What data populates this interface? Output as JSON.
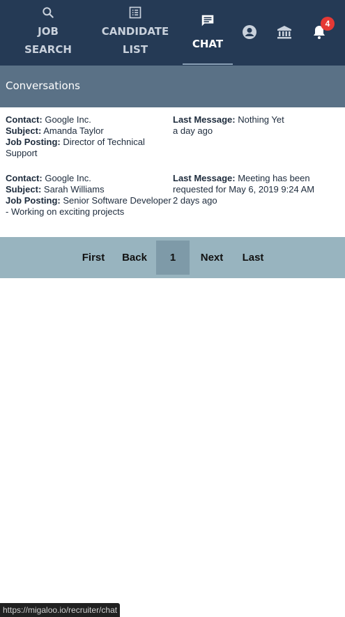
{
  "nav": {
    "items": [
      {
        "icon": "search-icon",
        "label_line1": "JOB",
        "label_line2": "SEARCH"
      },
      {
        "icon": "list-icon",
        "label_line1": "CANDIDATE",
        "label_line2": "LIST"
      },
      {
        "icon": "chat-icon",
        "label": "CHAT",
        "active": true
      }
    ],
    "notification_count": "4"
  },
  "conversations": {
    "title": "Conversations",
    "labels": {
      "contact": "Contact:",
      "subject": "Subject:",
      "job_posting": "Job Posting:",
      "last_message": "Last Message:"
    },
    "rows": [
      {
        "contact": "Google Inc.",
        "subject": "Amanda Taylor",
        "job_posting": "Director of Technical Support",
        "last_message": "Nothing Yet",
        "time": "a day ago"
      },
      {
        "contact": "Google Inc.",
        "subject": "Sarah Williams",
        "job_posting": "Senior Software Developer - Working on exciting projects",
        "last_message": "Meeting has been requested for May 6, 2019 9:24 AM",
        "time": "2 days ago"
      }
    ]
  },
  "pagination": {
    "first": "First",
    "back": "Back",
    "current": "1",
    "next": "Next",
    "last": "Last"
  },
  "status_url": "https://migaloo.io/recruiter/chat",
  "colors": {
    "nav_bg": "#253a55",
    "header_bg": "#5a7186",
    "pager_bg": "#98b4bf",
    "badge": "#e53935"
  }
}
